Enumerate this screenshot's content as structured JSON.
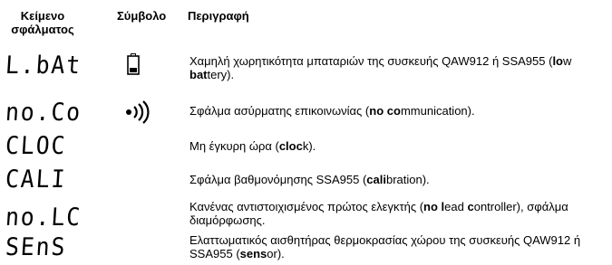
{
  "headers": {
    "code": "Κείμενο σφάλματος",
    "symbol": "Σύμβολο",
    "description": "Περιγραφή"
  },
  "rows": [
    {
      "code": "L.bAt",
      "symbol_icon": "battery-low-icon",
      "description": [
        {
          "t": "Χαμηλή χωρητικότητα μπαταριών της συσκευής QAW912 ή SSA955 (",
          "b": false
        },
        {
          "t": "lo",
          "b": true
        },
        {
          "t": "w ",
          "b": false
        },
        {
          "t": "bat",
          "b": true
        },
        {
          "t": "tery).",
          "b": false
        }
      ]
    },
    {
      "code": "no.Co",
      "symbol_icon": "wireless-signal-icon",
      "description": [
        {
          "t": "Σφάλμα ασύρματης επικοινωνίας (",
          "b": false
        },
        {
          "t": "no",
          "b": true
        },
        {
          "t": " ",
          "b": false
        },
        {
          "t": "co",
          "b": true
        },
        {
          "t": "mmunication).",
          "b": false
        }
      ]
    },
    {
      "code": "CLOC",
      "symbol_icon": "",
      "description": [
        {
          "t": "Μη έγκυρη ώρα (",
          "b": false
        },
        {
          "t": "cloc",
          "b": true
        },
        {
          "t": "k).",
          "b": false
        }
      ]
    },
    {
      "code": "CALI",
      "symbol_icon": "",
      "description": [
        {
          "t": "Σφάλμα βαθμονόμησης SSA955 (",
          "b": false
        },
        {
          "t": "cali",
          "b": true
        },
        {
          "t": "bration).",
          "b": false
        }
      ]
    },
    {
      "code": "no.LC",
      "symbol_icon": "",
      "description": [
        {
          "t": "Κανένας αντιστοιχισμένος πρώτος ελεγκτής (",
          "b": false
        },
        {
          "t": "no",
          "b": true
        },
        {
          "t": " ",
          "b": false
        },
        {
          "t": "l",
          "b": true
        },
        {
          "t": "ead ",
          "b": false
        },
        {
          "t": "c",
          "b": true
        },
        {
          "t": "ontroller), σφάλμα διαμόρφωσης.",
          "b": false
        }
      ]
    },
    {
      "code": "SEnS",
      "symbol_icon": "",
      "description": [
        {
          "t": "Ελαττωματικός αισθητήρας θερμοκρασίας χώρου της συσκευής QAW912 ή SSA955 (",
          "b": false
        },
        {
          "t": "sens",
          "b": true
        },
        {
          "t": "or).",
          "b": false
        }
      ]
    }
  ]
}
